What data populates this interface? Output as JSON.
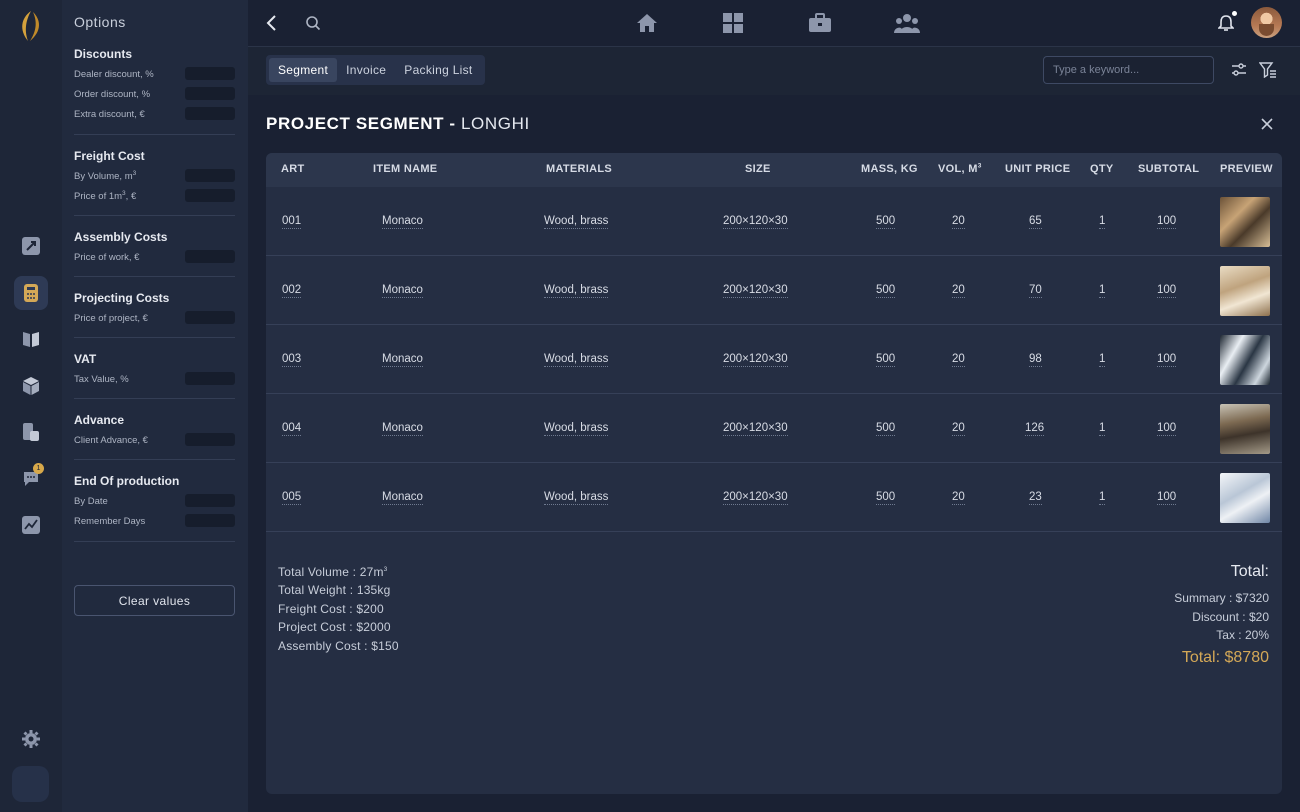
{
  "options": {
    "title": "Options",
    "groups": [
      {
        "title": "Discounts",
        "rows": [
          "Dealer discount, %",
          "Order discount, %",
          "Extra discount, €"
        ]
      },
      {
        "title": "Freight Cost",
        "rows": [
          "By Volume, m",
          "Price of 1m",
          ", €"
        ]
      },
      {
        "title": "Assembly Costs",
        "rows": [
          "Price of work, €"
        ]
      },
      {
        "title": "Projecting Costs",
        "rows": [
          "Price of project, €"
        ]
      },
      {
        "title": "VAT",
        "rows": [
          "Tax Value, %"
        ]
      },
      {
        "title": "Advance",
        "rows": [
          "Client Advance, €"
        ]
      },
      {
        "title": "End Of production",
        "rows": [
          "By Date",
          "Remember Days"
        ]
      }
    ],
    "clear_label": "Clear values",
    "sup3": "3"
  },
  "rail": {
    "badge": "1"
  },
  "tabs": [
    "Segment",
    "Invoice",
    "Packing List"
  ],
  "search": {
    "placeholder": "Type a keyword..."
  },
  "project": {
    "prefix": "PROJECT SEGMENT - ",
    "name": "LONGHI"
  },
  "table": {
    "headers": [
      "ART",
      "ITEM NAME",
      "MATERIALS",
      "SIZE",
      "MASS, KG",
      "VOL, M",
      "UNIT PRICE",
      "QTY",
      "SUBTOTAL",
      "PREVIEW"
    ],
    "rows": [
      {
        "art": "001",
        "name": "Monaco",
        "materials": "Wood, brass",
        "size": "200×120×30",
        "mass": "500",
        "vol": "20",
        "price": "65",
        "qty": "1",
        "subtotal": "100"
      },
      {
        "art": "002",
        "name": "Monaco",
        "materials": "Wood, brass",
        "size": "200×120×30",
        "mass": "500",
        "vol": "20",
        "price": "70",
        "qty": "1",
        "subtotal": "100"
      },
      {
        "art": "003",
        "name": "Monaco",
        "materials": "Wood, brass",
        "size": "200×120×30",
        "mass": "500",
        "vol": "20",
        "price": "98",
        "qty": "1",
        "subtotal": "100"
      },
      {
        "art": "004",
        "name": "Monaco",
        "materials": "Wood, brass",
        "size": "200×120×30",
        "mass": "500",
        "vol": "20",
        "price": "126",
        "qty": "1",
        "subtotal": "100"
      },
      {
        "art": "005",
        "name": "Monaco",
        "materials": "Wood, brass",
        "size": "200×120×30",
        "mass": "500",
        "vol": "20",
        "price": "23",
        "qty": "1",
        "subtotal": "100"
      }
    ]
  },
  "summary": {
    "left": {
      "volume": "Total Volume : 27m",
      "weight": "Total Weight : 135kg",
      "freight": "Freight Cost : $200",
      "project": "Project Cost : $2000",
      "assembly": "Assembly Cost : $150"
    },
    "right": {
      "heading": "Total:",
      "summary": "Summary : $7320",
      "discount": "Discount : $20",
      "tax": "Tax : 20%",
      "total": "Total: $8780"
    }
  },
  "colors": {
    "accent": "#d4a857",
    "background": "#1a2133",
    "card": "#252e43"
  }
}
